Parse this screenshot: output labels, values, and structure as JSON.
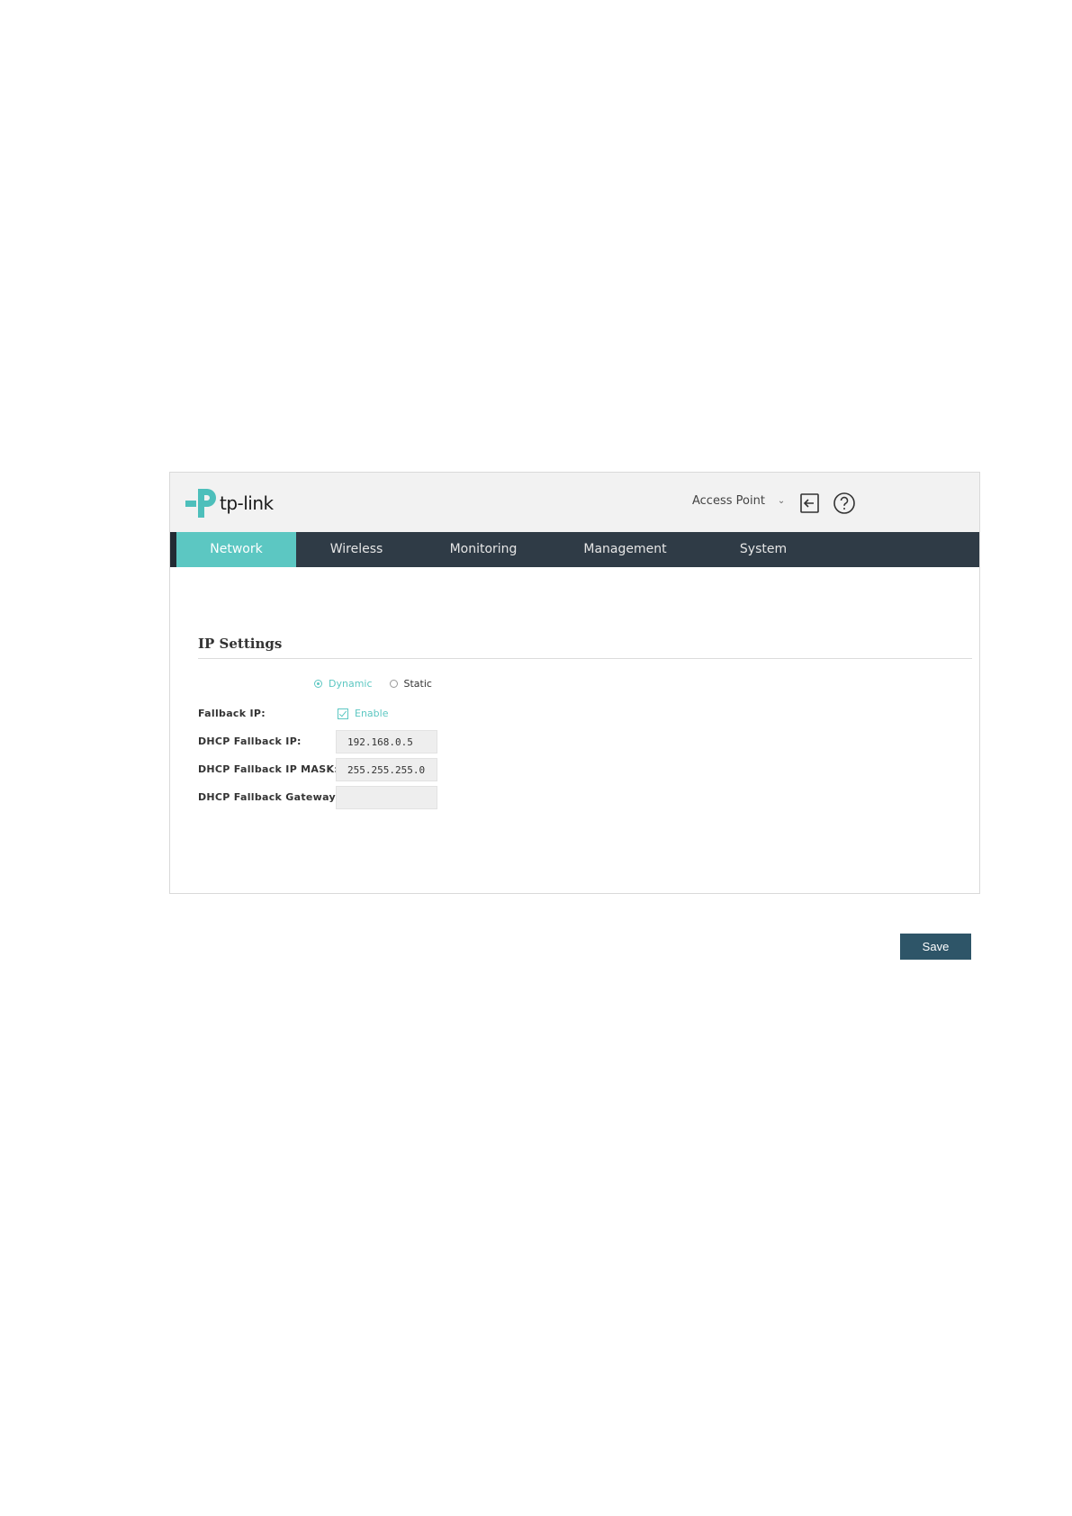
{
  "header": {
    "brand": "tp-link",
    "mode_label": "Access Point",
    "logout_icon": "logout-icon",
    "help_icon": "help-icon",
    "accent_color": "#5cc7c2"
  },
  "nav": {
    "tabs": [
      {
        "label": "Network",
        "active": true
      },
      {
        "label": "Wireless",
        "active": false
      },
      {
        "label": "Monitoring",
        "active": false
      },
      {
        "label": "Management",
        "active": false
      },
      {
        "label": "System",
        "active": false
      }
    ]
  },
  "ip_settings": {
    "title": "IP Settings",
    "mode_options": [
      {
        "label": "Dynamic",
        "selected": true
      },
      {
        "label": "Static",
        "selected": false
      }
    ],
    "fallback_ip_label": "Fallback IP:",
    "fallback_enable_label": "Enable",
    "fallback_enabled": true,
    "dhcp_fallback_ip_label": "DHCP Fallback IP:",
    "dhcp_fallback_ip_value": "192.168.0.5",
    "dhcp_fallback_mask_label": "DHCP Fallback IP MASK:",
    "dhcp_fallback_mask_value": "255.255.255.0",
    "dhcp_fallback_gateway_label": "DHCP Fallback Gateway:",
    "dhcp_fallback_gateway_value": ""
  },
  "actions": {
    "save_label": "Save"
  }
}
